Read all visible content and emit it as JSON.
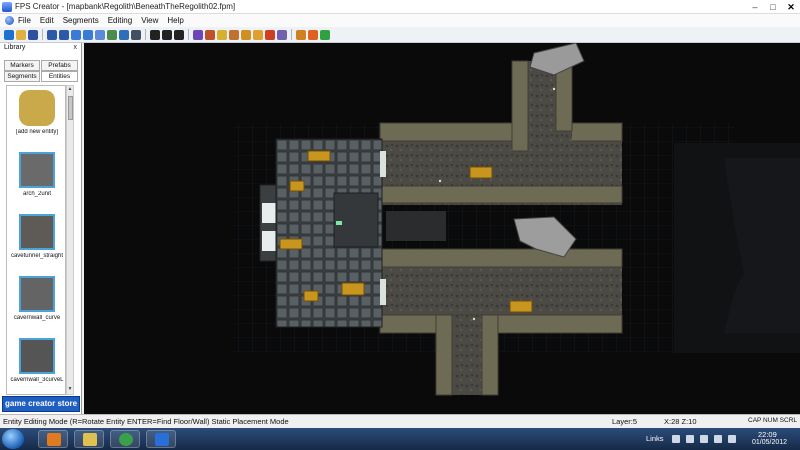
{
  "window": {
    "title": "FPS Creator - [mapbank\\Regolith\\BeneathTheRegolith02.fpm]",
    "controls": [
      "–",
      "□",
      "✕"
    ]
  },
  "menu": [
    "File",
    "Edit",
    "Segments",
    "Editing",
    "View",
    "Help"
  ],
  "toolbar": {
    "tools": [
      {
        "icon": "back-icon",
        "color": "#1f6fd0"
      },
      {
        "icon": "open-icon",
        "color": "#e0b040"
      },
      {
        "icon": "save-icon",
        "color": "#3050a0"
      },
      {
        "icon": "undo-icon",
        "color": "#2c5aa8"
      },
      {
        "icon": "redo-icon",
        "color": "#2c5aa8"
      },
      {
        "icon": "layer-up-icon",
        "color": "#3a7bd5"
      },
      {
        "icon": "layer-down-icon",
        "color": "#3a7bd5"
      },
      {
        "icon": "segment-icon",
        "color": "#5c8ad8"
      },
      {
        "icon": "entity-icon",
        "color": "#4d8a4d"
      },
      {
        "icon": "grid-icon",
        "color": "#2f6fb8"
      },
      {
        "icon": "zoom-icon",
        "color": "#405060"
      },
      {
        "icon": "line-icon",
        "color": "#222222"
      },
      {
        "icon": "rect-icon",
        "color": "#222222"
      },
      {
        "icon": "circle-icon",
        "color": "#222222"
      },
      {
        "icon": "picker-icon",
        "color": "#6b46b8"
      },
      {
        "icon": "paint-icon",
        "color": "#c0502a"
      },
      {
        "icon": "light-icon",
        "color": "#d8b030"
      },
      {
        "icon": "waypoint-icon",
        "color": "#c07030"
      },
      {
        "icon": "trigger-icon",
        "color": "#d09020"
      },
      {
        "icon": "marker-icon",
        "color": "#e0a030"
      },
      {
        "icon": "flag-icon",
        "color": "#d04020"
      },
      {
        "icon": "sound-icon",
        "color": "#7060b0"
      },
      {
        "icon": "test-game-icon",
        "color": "#d08020"
      },
      {
        "icon": "build-game-icon",
        "color": "#e06020"
      },
      {
        "icon": "run-icon",
        "color": "#30a040"
      }
    ]
  },
  "library": {
    "title": "Library",
    "close": "x",
    "tabs": {
      "markers": "Markers",
      "prefabs": "Prefabs",
      "segments": "Segments",
      "entities": "Entities"
    },
    "entries": [
      {
        "label": "[add new entity]",
        "thumb": "#c9a94a"
      },
      {
        "label": "arch_2unit",
        "thumb": "#6a6a6a"
      },
      {
        "label": "cavetunnel_straight",
        "thumb": "#5e5a55"
      },
      {
        "label": "cavernwall_curve",
        "thumb": "#646464"
      },
      {
        "label": "cavernwall_3curveL",
        "thumb": "#555555"
      }
    ],
    "store_label": "game creator store"
  },
  "status": {
    "mode": "Entity Editing Mode (R=Rotate Entity  ENTER=Find Floor/Wall)  Static Placement Mode",
    "layer": "Layer:5",
    "coords": "X:28  Z:10",
    "keys": "CAP  NUM  SCRL"
  },
  "taskbar": {
    "tray_label": "Links",
    "time": "22:09",
    "date": "01/05/2012",
    "apps": [
      {
        "name": "media-player",
        "color": "#e07a20"
      },
      {
        "name": "explorer",
        "color": "#e0c050"
      },
      {
        "name": "chrome",
        "color": "#3aa04a"
      },
      {
        "name": "tgc",
        "color": "#2a6fd8"
      }
    ]
  },
  "colors": {
    "viewport_bg": "#0a0a0a",
    "grid": "#1a2a3a",
    "floor": "#4a4a46",
    "wall": "#6e6b55",
    "crate": "#c8961e"
  }
}
